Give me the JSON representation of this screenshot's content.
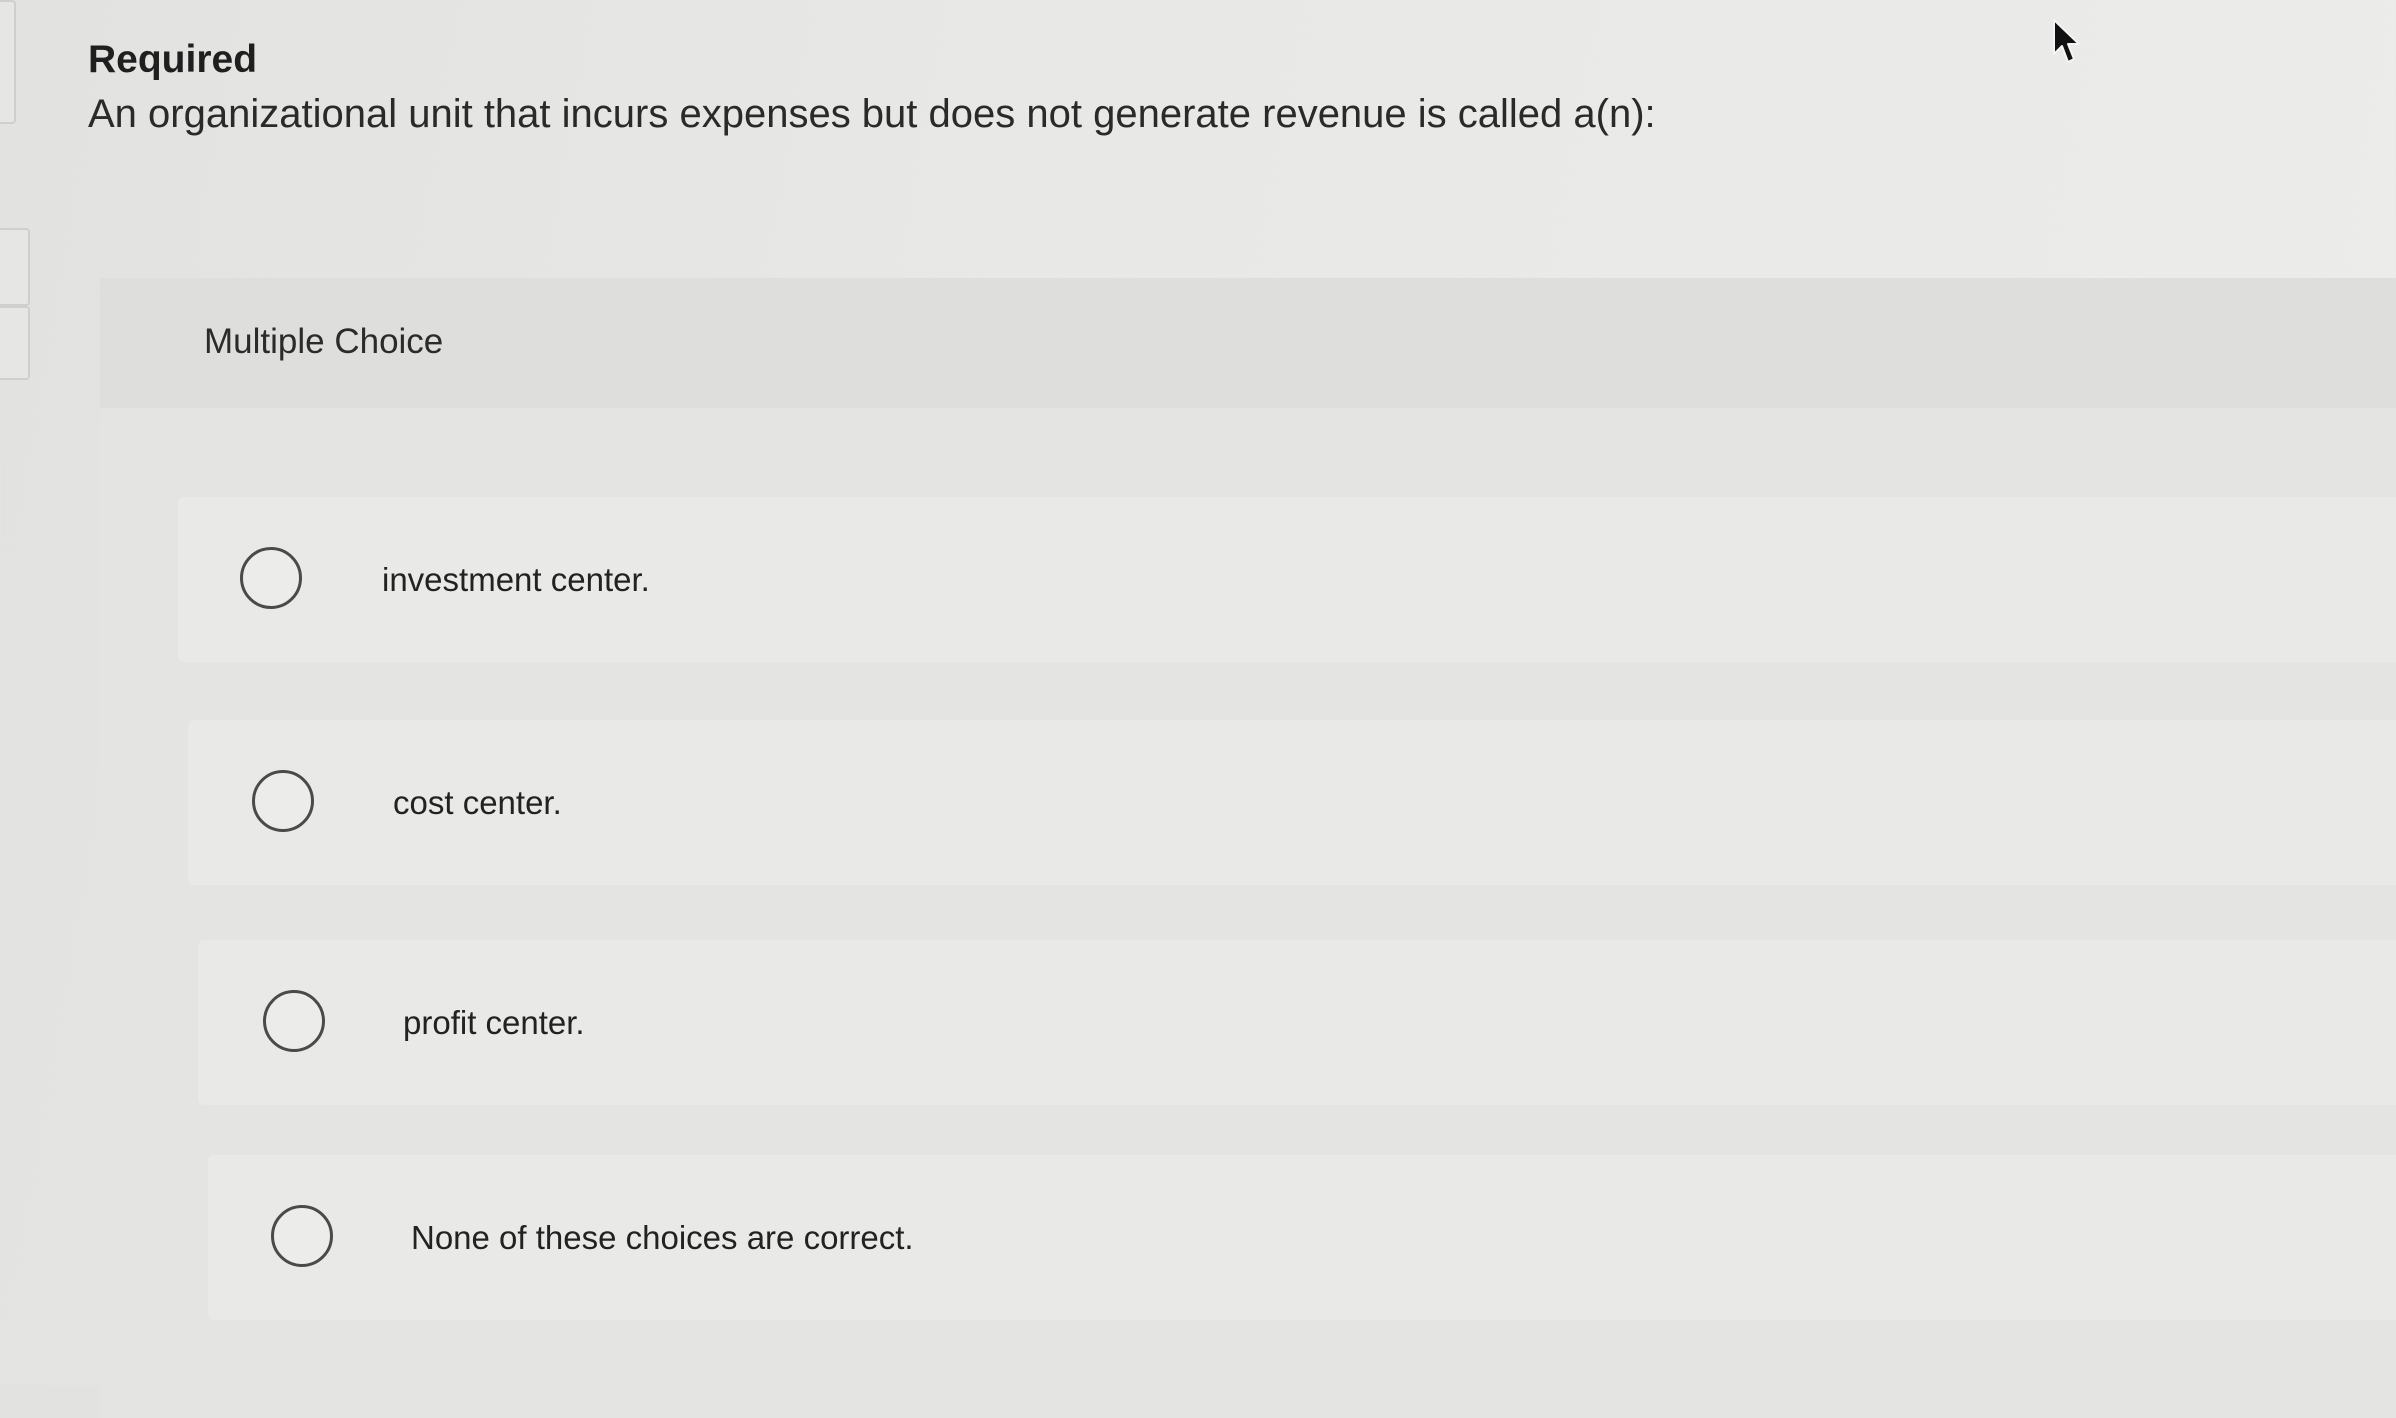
{
  "header": {
    "required_label": "Required",
    "question_text": "An organizational unit that incurs expenses but does not generate revenue is called a(n):"
  },
  "multiple_choice": {
    "title": "Multiple Choice",
    "options": [
      {
        "label": "investment center.",
        "selected": false
      },
      {
        "label": "cost center.",
        "selected": false
      },
      {
        "label": "profit center.",
        "selected": false
      },
      {
        "label": "None of these choices are correct.",
        "selected": false
      }
    ]
  },
  "icons": {
    "cursor": "mouse-pointer-icon",
    "radio": "radio-button-unselected-icon"
  },
  "colors": {
    "background": "#e8e8e6",
    "panel": "#e4e4e2",
    "option_row": "#e9e9e7",
    "radio_border": "#4a4a4a",
    "text": "#2b2b2b"
  }
}
